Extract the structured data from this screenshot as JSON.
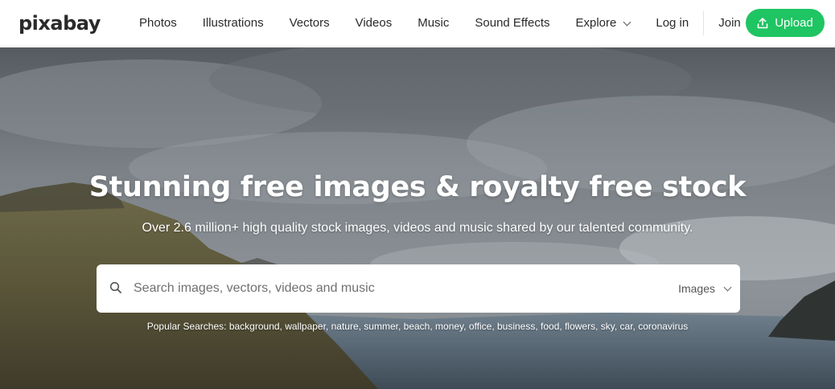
{
  "brand": {
    "logo": "pixabay"
  },
  "nav": {
    "items": [
      "Photos",
      "Illustrations",
      "Vectors",
      "Videos",
      "Music",
      "Sound Effects"
    ],
    "explore": "Explore",
    "login": "Log in",
    "join": "Join",
    "upload": "Upload"
  },
  "hero": {
    "title": "Stunning free images & royalty free stock",
    "subtitle": "Over 2.6 million+ high quality stock images, videos and music shared by our talented community."
  },
  "search": {
    "placeholder": "Search images, vectors, videos and music",
    "value": "",
    "type_selected": "Images"
  },
  "popular": {
    "label": "Popular Searches:",
    "terms": [
      "background",
      "wallpaper",
      "nature",
      "summer",
      "beach",
      "money",
      "office",
      "business",
      "food",
      "flowers",
      "sky",
      "car",
      "coronavirus"
    ]
  },
  "colors": {
    "accent": "#1ec562",
    "text": "#2a2a2a"
  },
  "icons": {
    "upload": "upload-icon",
    "search": "search-icon",
    "chevron": "chevron-down-icon"
  }
}
